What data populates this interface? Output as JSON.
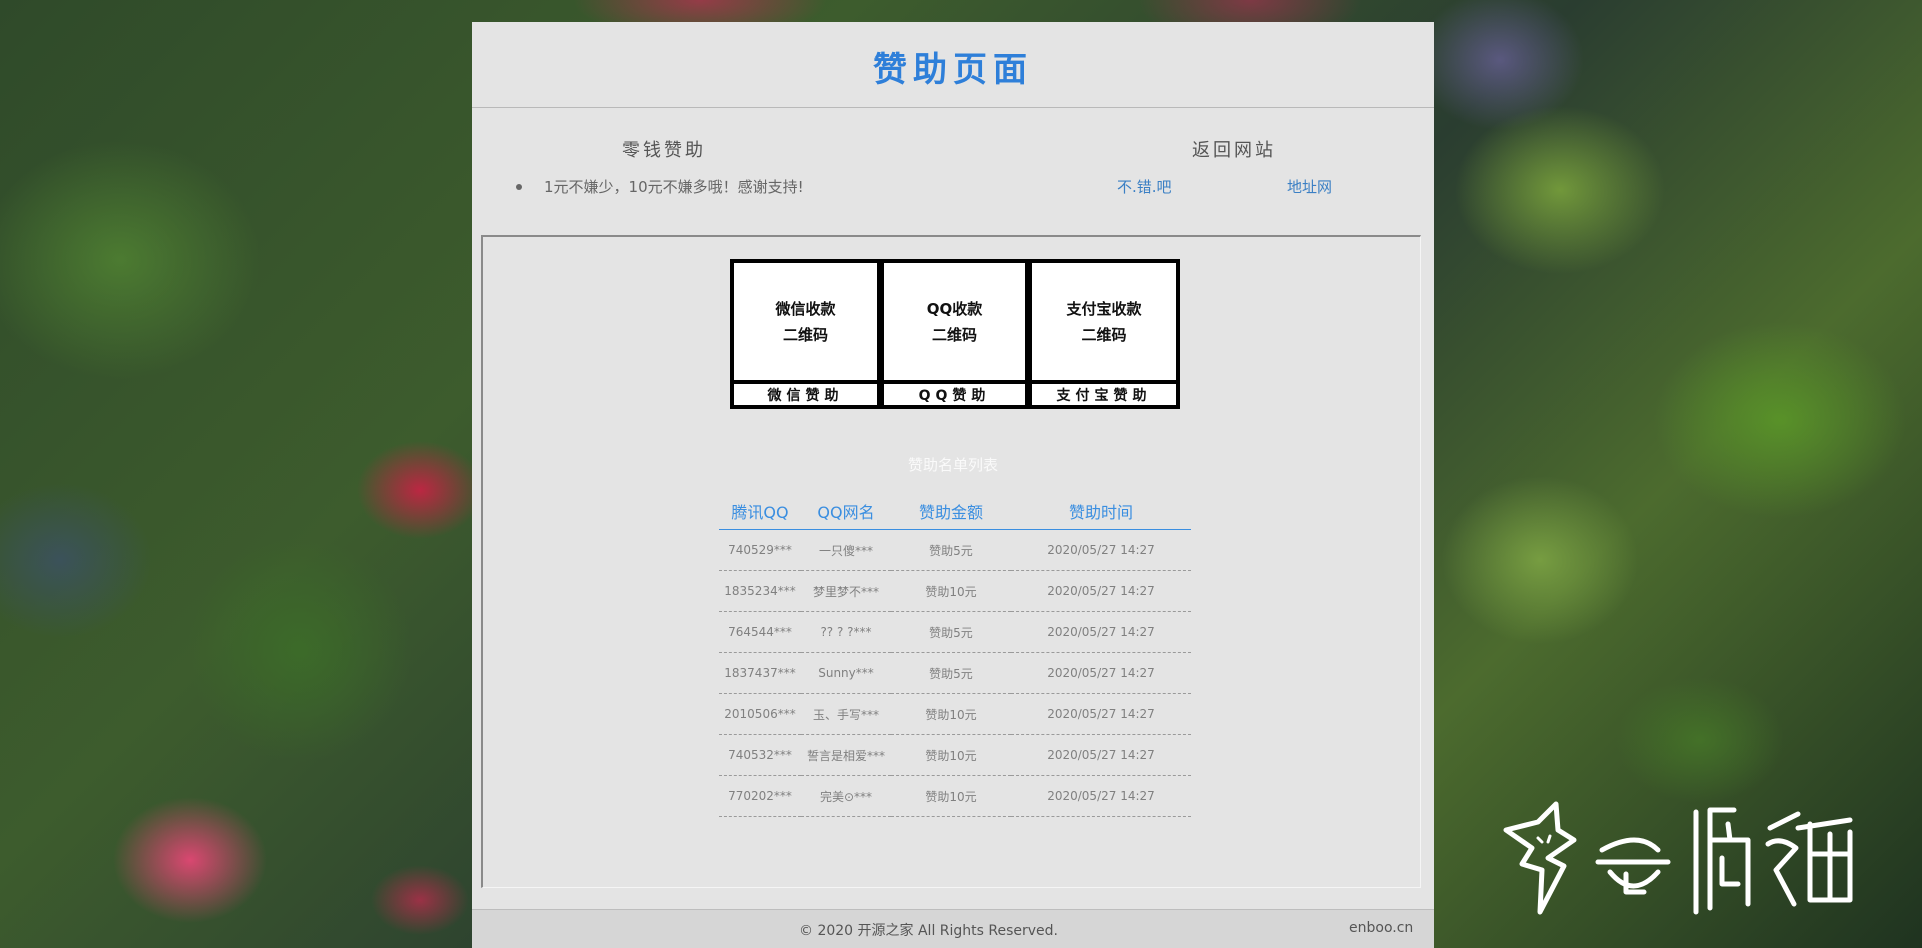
{
  "header": {
    "title": "赞助页面"
  },
  "info": {
    "sponsor_heading": "零钱赞助",
    "sponsor_note": "1元不嫌少，10元不嫌多哦！感谢支持!",
    "return_heading": "返回网站",
    "links": [
      "不.错.吧",
      "地址网"
    ]
  },
  "qr_cards": [
    {
      "line1": "微信收款",
      "line2": "二维码",
      "label": "微信赞助"
    },
    {
      "line1": "QQ收款",
      "line2": "二维码",
      "label": "QQ赞助"
    },
    {
      "line1": "支付宝收款",
      "line2": "二维码",
      "label": "支付宝赞助"
    }
  ],
  "sponsor_list": {
    "title": "赞助名单列表",
    "columns": [
      "腾讯QQ",
      "QQ网名",
      "赞助金额",
      "赞助时间"
    ],
    "rows": [
      [
        "740529***",
        "一只傻***",
        "赞助5元",
        "2020/05/27 14:27"
      ],
      [
        "1835234***",
        "梦里梦不***",
        "赞助10元",
        "2020/05/27 14:27"
      ],
      [
        "764544***",
        "?? ? ?***",
        "赞助5元",
        "2020/05/27 14:27"
      ],
      [
        "1837437***",
        "Sunny***",
        "赞助5元",
        "2020/05/27 14:27"
      ],
      [
        "2010506***",
        "玉、手写***",
        "赞助10元",
        "2020/05/27 14:27"
      ],
      [
        "740532***",
        "誓言是相爱***",
        "赞助10元",
        "2020/05/27 14:27"
      ],
      [
        "770202***",
        "完美⊙***",
        "赞助10元",
        "2020/05/27 14:27"
      ]
    ]
  },
  "footer": {
    "copyright": "© 2020 开源之家 All Rights Reserved.",
    "domain": "enboo.cn"
  },
  "watermark": {
    "text": "奇偶猫"
  },
  "colors": {
    "accent": "#2e7fd9",
    "panel_bg": "#e4e4e4",
    "link": "#3a7fc4"
  }
}
